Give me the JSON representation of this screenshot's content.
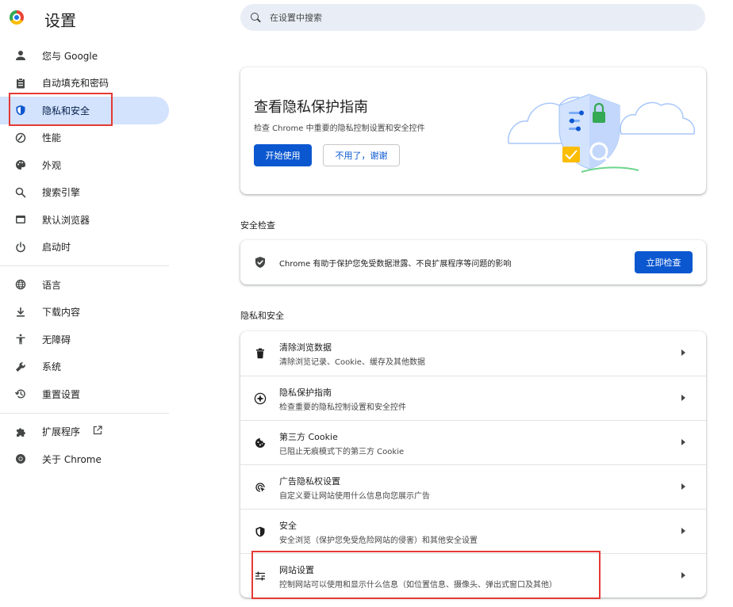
{
  "app": {
    "title": "设置"
  },
  "search": {
    "placeholder": "在设置中搜索"
  },
  "sidebar": {
    "items": [
      {
        "label": "您与 Google"
      },
      {
        "label": "自动填充和密码"
      },
      {
        "label": "隐私和安全"
      },
      {
        "label": "性能"
      },
      {
        "label": "外观"
      },
      {
        "label": "搜索引擎"
      },
      {
        "label": "默认浏览器"
      },
      {
        "label": "启动时"
      },
      {
        "label": "语言"
      },
      {
        "label": "下载内容"
      },
      {
        "label": "无障碍"
      },
      {
        "label": "系统"
      },
      {
        "label": "重置设置"
      },
      {
        "label": "扩展程序"
      },
      {
        "label": "关于 Chrome"
      }
    ]
  },
  "promo": {
    "title": "查看隐私保护指南",
    "description": "检查 Chrome 中重要的隐私控制设置和安全控件",
    "primary_label": "开始使用",
    "secondary_label": "不用了，谢谢"
  },
  "safety_check": {
    "section_title": "安全检查",
    "text": "Chrome 有助于保护您免受数据泄露、不良扩展程序等问题的影响",
    "button_label": "立即检查"
  },
  "privacy": {
    "section_title": "隐私和安全",
    "rows": [
      {
        "title": "清除浏览数据",
        "subtitle": "清除浏览记录、Cookie、缓存及其他数据"
      },
      {
        "title": "隐私保护指南",
        "subtitle": "检查重要的隐私控制设置和安全控件"
      },
      {
        "title": "第三方 Cookie",
        "subtitle": "已阻止无痕模式下的第三方 Cookie"
      },
      {
        "title": "广告隐私权设置",
        "subtitle": "自定义要让网站使用什么信息向您展示广告"
      },
      {
        "title": "安全",
        "subtitle": "安全浏览（保护您免受危险网站的侵害）和其他安全设置"
      },
      {
        "title": "网站设置",
        "subtitle": "控制网站可以使用和显示什么信息（如位置信息、摄像头、弹出式窗口及其他）"
      }
    ]
  },
  "colors": {
    "accent": "#0b57d0",
    "active_nav_bg": "#d3e3fd",
    "highlight": "#e53935",
    "search_bg": "#e9eef6"
  }
}
